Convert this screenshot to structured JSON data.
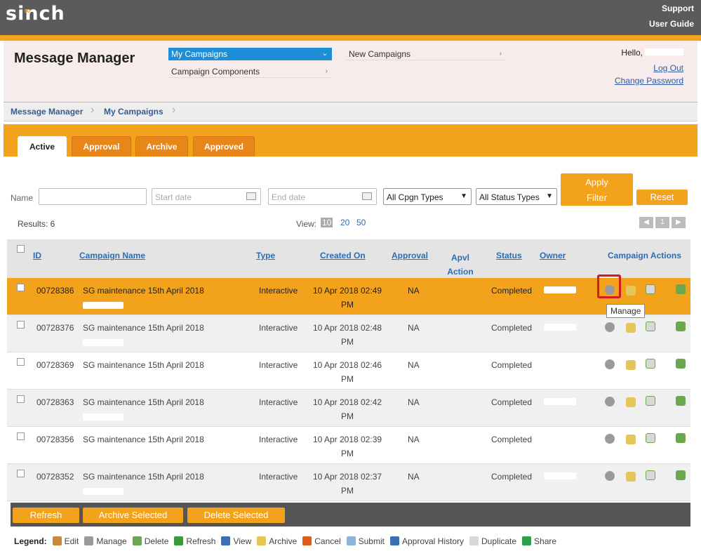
{
  "brand": {
    "logo": "sinch"
  },
  "top_links": {
    "support": "Support",
    "user_guide": "User Guide"
  },
  "app": {
    "title": "Message Manager"
  },
  "nav": {
    "my_campaigns": "My Campaigns",
    "campaign_components": "Campaign Components",
    "new_campaigns": "New Campaigns"
  },
  "user": {
    "hello": "Hello,",
    "logout": "Log Out",
    "change_password": "Change Password"
  },
  "breadcrumb": [
    "Message Manager",
    "My Campaigns"
  ],
  "tabs": [
    "Active",
    "Approval",
    "Archive",
    "Approved"
  ],
  "filters": {
    "name_label": "Name",
    "start_placeholder": "Start date",
    "end_placeholder": "End date",
    "cpgn_type": "All Cpgn Types",
    "status_type": "All Status Types",
    "apply": "Apply Filter",
    "reset": "Reset"
  },
  "results": {
    "text": "Results: 6",
    "view_label": "View:",
    "view_options": [
      "10",
      "20",
      "50"
    ],
    "page": "1"
  },
  "columns": {
    "id": "ID",
    "name": "Campaign Name",
    "type": "Type",
    "created": "Created On",
    "approval": "Approval",
    "apvl_action": "Apvl Action",
    "status": "Status",
    "owner": "Owner",
    "actions": "Campaign Actions"
  },
  "rows": [
    {
      "id": "00728386",
      "name": "SG maintenance 15th April 2018",
      "type": "Interactive",
      "created": "10 Apr 2018 02:49 PM",
      "approval": "NA",
      "status": "Completed"
    },
    {
      "id": "00728376",
      "name": "SG maintenance 15th April 2018",
      "type": "Interactive",
      "created": "10 Apr 2018 02:48 PM",
      "approval": "NA",
      "status": "Completed"
    },
    {
      "id": "00728369",
      "name": "SG maintenance 15th April 2018",
      "type": "Interactive",
      "created": "10 Apr 2018 02:46 PM",
      "approval": "NA",
      "status": "Completed"
    },
    {
      "id": "00728363",
      "name": "SG maintenance 15th April 2018",
      "type": "Interactive",
      "created": "10 Apr 2018 02:42 PM",
      "approval": "NA",
      "status": "Completed"
    },
    {
      "id": "00728356",
      "name": "SG maintenance 15th April 2018",
      "type": "Interactive",
      "created": "10 Apr 2018 02:39 PM",
      "approval": "NA",
      "status": "Completed"
    },
    {
      "id": "00728352",
      "name": "SG maintenance 15th April 2018",
      "type": "Interactive",
      "created": "10 Apr 2018 02:37 PM",
      "approval": "NA",
      "status": "Completed"
    }
  ],
  "tooltip": "Manage",
  "footer_buttons": {
    "refresh": "Refresh",
    "archive": "Archive Selected",
    "delete": "Delete Selected"
  },
  "legend": {
    "label": "Legend:",
    "items": [
      "Edit",
      "Manage",
      "Delete",
      "Refresh",
      "View",
      "Archive",
      "Cancel",
      "Submit",
      "Approval History",
      "Duplicate",
      "Share"
    ]
  },
  "colors": {
    "accent": "#f3a21c",
    "topbar": "#5b5b5b",
    "link": "#2b6db5"
  }
}
